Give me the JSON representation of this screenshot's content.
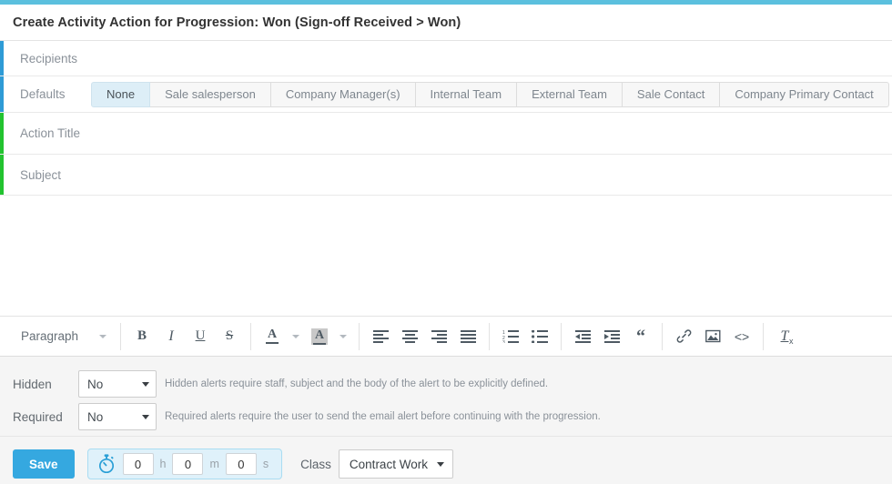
{
  "window": {
    "title": "Create Activity Action for Progression: Won (Sign-off Received > Won)",
    "accent_top_color": "#5bc0de",
    "accent_blue": "#2e9bd6",
    "accent_green": "#22c32f"
  },
  "recipients": {
    "placeholder": "Recipients",
    "defaults_label": "Defaults",
    "tabs": [
      {
        "label": "None",
        "active": true
      },
      {
        "label": "Sale salesperson",
        "active": false
      },
      {
        "label": "Company Manager(s)",
        "active": false
      },
      {
        "label": "Internal Team",
        "active": false
      },
      {
        "label": "External Team",
        "active": false
      },
      {
        "label": "Sale Contact",
        "active": false
      },
      {
        "label": "Company Primary Contact",
        "active": false
      }
    ]
  },
  "fields": {
    "action_title_placeholder": "Action Title",
    "subject_placeholder": "Subject",
    "body_value": ""
  },
  "editor": {
    "paragraph_label": "Paragraph",
    "buttons": [
      {
        "name": "bold-icon",
        "glyph": "B"
      },
      {
        "name": "italic-icon",
        "glyph": "I"
      },
      {
        "name": "underline-icon",
        "glyph": "U"
      },
      {
        "name": "strikethrough-icon",
        "glyph": "S"
      },
      {
        "name": "text-color-icon",
        "glyph": "A"
      },
      {
        "name": "highlight-color-icon",
        "glyph": "A"
      },
      {
        "name": "align-left-icon",
        "glyph": ""
      },
      {
        "name": "align-center-icon",
        "glyph": ""
      },
      {
        "name": "align-right-icon",
        "glyph": ""
      },
      {
        "name": "align-justify-icon",
        "glyph": ""
      },
      {
        "name": "ordered-list-icon",
        "glyph": ""
      },
      {
        "name": "unordered-list-icon",
        "glyph": ""
      },
      {
        "name": "outdent-icon",
        "glyph": ""
      },
      {
        "name": "indent-icon",
        "glyph": ""
      },
      {
        "name": "blockquote-icon",
        "glyph": "“"
      },
      {
        "name": "link-icon",
        "glyph": ""
      },
      {
        "name": "image-icon",
        "glyph": ""
      },
      {
        "name": "source-code-icon",
        "glyph": "<>"
      },
      {
        "name": "clear-formatting-icon",
        "glyph": "T"
      }
    ]
  },
  "options": {
    "hidden": {
      "label": "Hidden",
      "value": "No",
      "help": "Hidden alerts require staff, subject and the body of the alert to be explicitly defined."
    },
    "required": {
      "label": "Required",
      "value": "No",
      "help": "Required alerts require the user to send the email alert before continuing with the progression."
    }
  },
  "footer": {
    "save_label": "Save",
    "timer": {
      "hours": "0",
      "minutes": "0",
      "seconds": "0",
      "hours_unit": "h",
      "minutes_unit": "m",
      "seconds_unit": "s"
    },
    "class_label": "Class",
    "class_value": "Contract Work"
  }
}
